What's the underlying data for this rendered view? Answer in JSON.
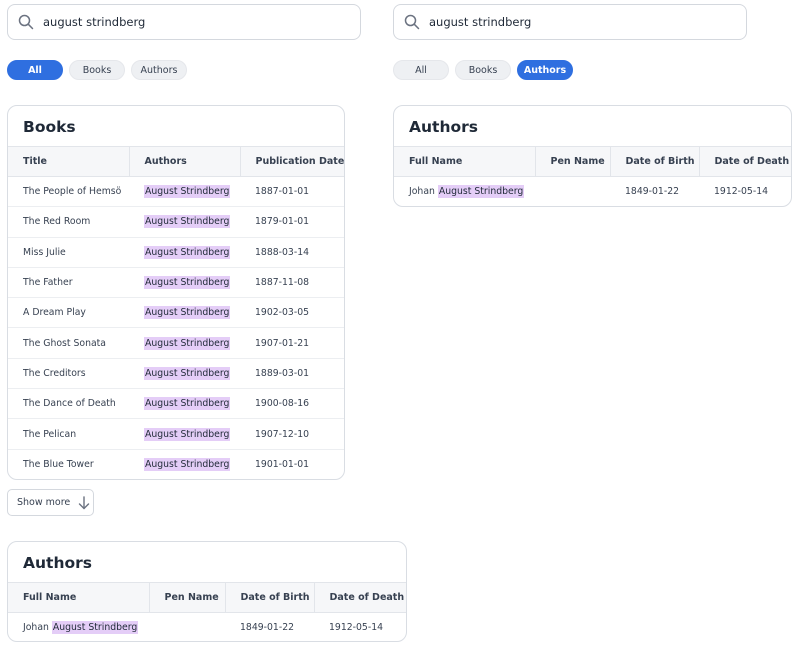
{
  "left": {
    "search": {
      "value": "august strindberg",
      "icon": "search-icon"
    },
    "tabs": [
      {
        "label": "All",
        "active": true
      },
      {
        "label": "Books",
        "active": false
      },
      {
        "label": "Authors",
        "active": false
      }
    ],
    "books": {
      "title": "Books",
      "columns": [
        "Title",
        "Authors",
        "Publication Date"
      ],
      "rows": [
        {
          "title": "The People of Hemsö",
          "author": "August Strindberg",
          "date": "1887-01-01"
        },
        {
          "title": "The Red Room",
          "author": "August Strindberg",
          "date": "1879-01-01"
        },
        {
          "title": "Miss Julie",
          "author": "August Strindberg",
          "date": "1888-03-14"
        },
        {
          "title": "The Father",
          "author": "August Strindberg",
          "date": "1887-11-08"
        },
        {
          "title": "A Dream Play",
          "author": "August Strindberg",
          "date": "1902-03-05"
        },
        {
          "title": "The Ghost Sonata",
          "author": "August Strindberg",
          "date": "1907-01-21"
        },
        {
          "title": "The Creditors",
          "author": "August Strindberg",
          "date": "1889-03-01"
        },
        {
          "title": "The Dance of Death",
          "author": "August Strindberg",
          "date": "1900-08-16"
        },
        {
          "title": "The Pelican",
          "author": "August Strindberg",
          "date": "1907-12-10"
        },
        {
          "title": "The Blue Tower",
          "author": "August Strindberg",
          "date": "1901-01-01"
        }
      ]
    },
    "show_more_label": "Show more",
    "authors": {
      "title": "Authors",
      "columns": [
        "Full Name",
        "Pen Name",
        "Date of Birth",
        "Date of Death"
      ],
      "rows": [
        {
          "first": "Johan",
          "highlight": "August Strindberg",
          "pen_name": "",
          "birth": "1849-01-22",
          "death": "1912-05-14"
        }
      ]
    }
  },
  "right": {
    "search": {
      "value": "august strindberg",
      "icon": "search-icon"
    },
    "tabs": [
      {
        "label": "All",
        "active": false
      },
      {
        "label": "Books",
        "active": false
      },
      {
        "label": "Authors",
        "active": true
      }
    ],
    "authors": {
      "title": "Authors",
      "columns": [
        "Full Name",
        "Pen Name",
        "Date of Birth",
        "Date of Death"
      ],
      "rows": [
        {
          "first": "Johan",
          "highlight": "August Strindberg",
          "pen_name": "",
          "birth": "1849-01-22",
          "death": "1912-05-14"
        }
      ]
    }
  },
  "colors": {
    "accent": "#2f6fe0",
    "highlight": "#e4cdf7",
    "border": "#d9dde3",
    "header_bg": "#f6f7f9"
  }
}
